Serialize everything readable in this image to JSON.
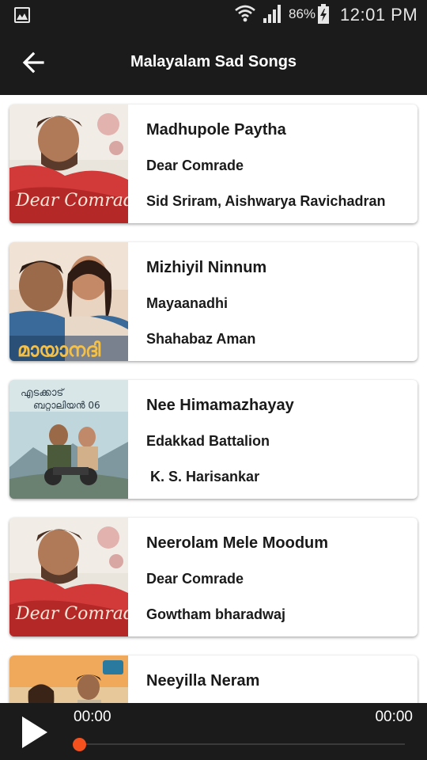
{
  "status_bar": {
    "battery_percent": "86%",
    "time": "12:01 PM",
    "icons": [
      "gallery-icon",
      "wifi-icon",
      "signal-icon",
      "battery-charging-icon"
    ]
  },
  "toolbar": {
    "title": "Malayalam Sad Songs",
    "back_icon": "arrow-left-icon"
  },
  "songs": [
    {
      "title": "Madhupole Paytha",
      "album": "Dear Comrade",
      "artist": "Sid Sriram, Aishwarya Ravichadran"
    },
    {
      "title": "Mizhiyil Ninnum",
      "album": "Mayaanadhi",
      "artist": "Shahabaz Aman"
    },
    {
      "title": "Nee Himamazhayay",
      "album": "Edakkad Battalion",
      "artist": " K. S. Harisankar"
    },
    {
      "title": "Neerolam Mele Moodum",
      "album": "Dear Comrade",
      "artist": "Gowtham bharadwaj"
    },
    {
      "title": "Neeyilla Neram",
      "album": "",
      "artist": ""
    }
  ],
  "player": {
    "current_time": "00:00",
    "total_time": "00:00",
    "progress": 0,
    "accent_color": "#f4511e",
    "play_icon": "play-icon"
  }
}
